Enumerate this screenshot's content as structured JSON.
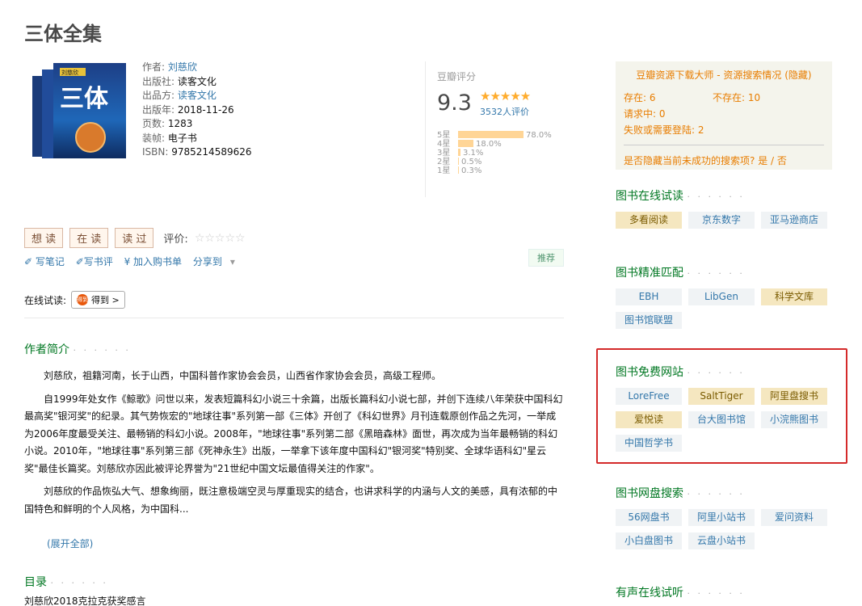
{
  "book": {
    "title": "三体全集",
    "cover_text": {
      "author": "刘慈欣",
      "title": "三体"
    },
    "info": [
      {
        "label": "作者:",
        "value": "刘慈欣",
        "link": true
      },
      {
        "label": "出版社:",
        "value": "读客文化",
        "link": false
      },
      {
        "label": "出品方:",
        "value": "读客文化",
        "link": true
      },
      {
        "label": "出版年:",
        "value": "2018-11-26",
        "link": false
      },
      {
        "label": "页数:",
        "value": "1283",
        "link": false
      },
      {
        "label": "装帧:",
        "value": "电子书",
        "link": false
      },
      {
        "label": "ISBN:",
        "value": "9785214589626",
        "link": false
      }
    ]
  },
  "rating": {
    "label": "豆瓣评分",
    "score": "9.3",
    "stars": "★★★★★",
    "count": "3532人评价",
    "distribution": [
      {
        "label": "5星",
        "value": "78.0%",
        "fraction": 0.78
      },
      {
        "label": "4星",
        "value": "18.0%",
        "fraction": 0.18
      },
      {
        "label": "3星",
        "value": "3.1%",
        "fraction": 0.031
      },
      {
        "label": "2星",
        "value": "0.5%",
        "fraction": 0.005
      },
      {
        "label": "1星",
        "value": "0.3%",
        "fraction": 0.003
      }
    ]
  },
  "collect": {
    "want": "想 读",
    "doing": "在 读",
    "done": "读 过",
    "rate_label": "评价:",
    "rate_stars": "☆☆☆☆☆"
  },
  "actions": {
    "note": "✐ 写笔记",
    "review": "✐写书评",
    "cart": "¥ 加入购书单",
    "share": "分享到",
    "share_arrow": "▾",
    "recommend": "推荐"
  },
  "online_trial": {
    "label": "在线试读:",
    "logo": "得到",
    "source": "得到 >"
  },
  "author_intro": {
    "heading": "作者简介",
    "dots": "· · · · · ·",
    "paragraphs": [
      "刘慈欣，祖籍河南，长于山西，中国科普作家协会会员，山西省作家协会会员，高级工程师。",
      "自1999年处女作《鲸歌》问世以来，发表短篇科幻小说三十余篇，出版长篇科幻小说七部，并创下连续八年荣获中国科幻最高奖\"银河奖\"的纪录。其气势恢宏的\"地球往事\"系列第一部《三体》开创了《科幻世界》月刊连载原创作品之先河，一举成为2006年度最受关注、最畅销的科幻小说。2008年，\"地球往事\"系列第二部《黑暗森林》面世，再次成为当年最畅销的科幻小说。2010年，\"地球往事\"系列第三部《死神永生》出版，一举拿下该年度中国科幻\"银河奖\"特别奖、全球华语科幻\"星云奖\"最佳长篇奖。刘慈欣亦因此被评论界誉为\"21世纪中国文坛最值得关注的作家\"。",
      "刘慈欣的作品恢弘大气、想象绚丽，既注意极端空灵与厚重现实的结合，也讲求科学的内涵与人文的美感，具有浓郁的中国特色和鲜明的个人风格，为中国科..."
    ],
    "expand": "(展开全部)"
  },
  "toc": {
    "heading": "目录",
    "dots": "· · · · · ·",
    "first": "刘慈欣2018克拉克获奖感言"
  },
  "sidebar": {
    "status": {
      "head": "豆瓣资源下载大师 - 资源搜索情况 (隐藏)",
      "exist": "存在: 6",
      "not_exist": "不存在: 10",
      "requesting": "请求中: 0",
      "failed": "失败或需要登陆: 2",
      "question": "是否隐藏当前未成功的搜索项?",
      "yes": "是",
      "slash": "/",
      "no": "否"
    },
    "sections": [
      {
        "title": "图书在线试读",
        "dots": "· · · · · ·",
        "tags": [
          {
            "label": "多看阅读",
            "hl": true
          },
          {
            "label": "京东数字",
            "hl": false
          },
          {
            "label": "亚马逊商店",
            "hl": false
          }
        ]
      },
      {
        "title": "图书精准匹配",
        "dots": "· · · · · ·",
        "tags": [
          {
            "label": "EBH",
            "hl": false
          },
          {
            "label": "LibGen",
            "hl": false
          },
          {
            "label": "科学文库",
            "hl": true
          },
          {
            "label": "图书馆联盟",
            "hl": false
          }
        ]
      },
      {
        "title": "图书免费网站",
        "dots": "· · · · · ·",
        "tags": [
          {
            "label": "LoreFree",
            "hl": false
          },
          {
            "label": "SaltTiger",
            "hl": true
          },
          {
            "label": "阿里盘搜书",
            "hl": true
          },
          {
            "label": "爱悦读",
            "hl": true
          },
          {
            "label": "台大图书馆",
            "hl": false
          },
          {
            "label": "小浣熊图书",
            "hl": false
          },
          {
            "label": "中国哲学书",
            "hl": false
          }
        ]
      },
      {
        "title": "图书网盘搜索",
        "dots": "· · · · · ·",
        "tags": [
          {
            "label": "56网盘书",
            "hl": false
          },
          {
            "label": "阿里小站书",
            "hl": false
          },
          {
            "label": "爱问资料",
            "hl": false
          },
          {
            "label": "小白盘图书",
            "hl": false
          },
          {
            "label": "云盘小站书",
            "hl": false
          }
        ]
      },
      {
        "title": "有声在线试听",
        "dots": "· · · · · ·",
        "tags": []
      }
    ]
  }
}
